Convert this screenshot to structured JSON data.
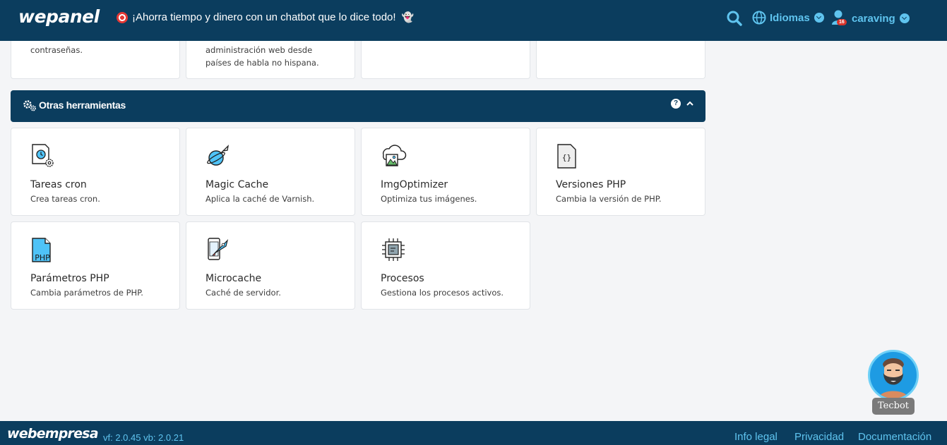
{
  "header": {
    "logo": "wepanel",
    "promo_text": "¡Ahorra tiempo y dinero con un chatbot que lo dice todo!",
    "languages_label": "Idiomas",
    "username": "caraving",
    "notification_count": "16"
  },
  "top_cards": [
    {
      "desc_lines": [
        "contraseñas."
      ]
    },
    {
      "desc_lines": [
        "administración web desde",
        "países de habla no hispana."
      ]
    },
    {
      "desc_lines": []
    },
    {
      "desc_lines": []
    }
  ],
  "section": {
    "title": "Otras herramientas",
    "help_label": "?"
  },
  "tools": [
    {
      "title": "Tareas cron",
      "desc": "Crea tareas cron.",
      "icon": "cron-tasks-icon"
    },
    {
      "title": "Magic Cache",
      "desc": "Aplica la caché de Varnish.",
      "icon": "magic-cache-icon"
    },
    {
      "title": "ImgOptimizer",
      "desc": "Optimiza tus imágenes.",
      "icon": "image-optimizer-icon"
    },
    {
      "title": "Versiones PHP",
      "desc": "Cambia la versión de PHP.",
      "icon": "php-versions-icon"
    },
    {
      "title": "Parámetros PHP",
      "desc": "Cambia parámetros de PHP.",
      "icon": "php-parameters-icon",
      "icon_text": "PHP"
    },
    {
      "title": "Microcache",
      "desc": "Caché de servidor.",
      "icon": "microcache-icon"
    },
    {
      "title": "Procesos",
      "desc": "Gestiona los procesos activos.",
      "icon": "processes-icon"
    }
  ],
  "chatbot": {
    "label": "Tecbot"
  },
  "footer": {
    "logo": "webempresa",
    "version": "vf: 2.0.45 vb: 2.0.21",
    "links": [
      "Info legal",
      "Privacidad",
      "Documentación"
    ]
  },
  "colors": {
    "primary": "#0b3d5e",
    "accent": "#5fc4ef",
    "background": "#f4f5f7"
  }
}
